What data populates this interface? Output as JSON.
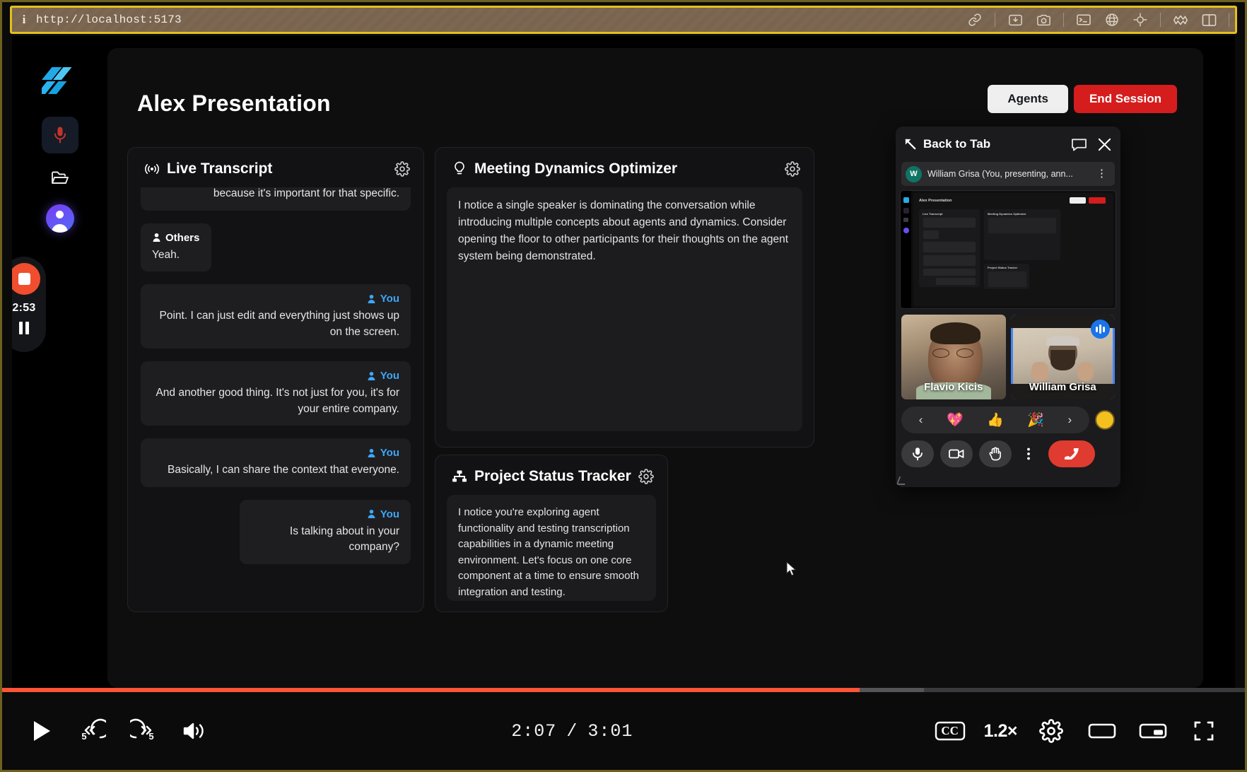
{
  "browser": {
    "info_icon": "info-icon",
    "url": "http://localhost:5173",
    "toolbar_icons": [
      "link-icon",
      "download-image-icon",
      "camera-icon",
      "terminal-icon",
      "globe-icon",
      "target-icon",
      "cloud-icon",
      "panel-split-icon"
    ]
  },
  "sidebar": {
    "logo": "app-logo",
    "items": [
      {
        "name": "microphone-icon",
        "active": true
      },
      {
        "name": "folder-icon",
        "active": false
      },
      {
        "name": "user-avatar",
        "active": false
      }
    ],
    "recorder": {
      "stop_label": "stop-recording",
      "elapsed": "2:53",
      "pause_label": "pause-recording"
    }
  },
  "header": {
    "title": "Alex Presentation",
    "agents_label": "Agents",
    "end_session_label": "End Session"
  },
  "panels": {
    "transcript": {
      "icon": "broadcast-icon",
      "title": "Live Transcript",
      "gear": "settings-gear-icon",
      "messages": [
        {
          "speaker": "",
          "align": "right",
          "clipped": true,
          "text": "A project status tracker added to your meeting because it's important for that specific."
        },
        {
          "speaker": "Others",
          "align": "left",
          "clipped": false,
          "text": "Yeah."
        },
        {
          "speaker": "You",
          "align": "right",
          "clipped": false,
          "text": "Point. I can just edit and everything just shows up on the screen."
        },
        {
          "speaker": "You",
          "align": "right",
          "clipped": false,
          "text": "And another good thing. It's not just for you, it's for your entire company."
        },
        {
          "speaker": "You",
          "align": "right",
          "clipped": false,
          "text": "Basically, I can share the context that everyone."
        },
        {
          "speaker": "You",
          "align": "right",
          "clipped": false,
          "text": "Is talking about in your company?"
        }
      ]
    },
    "dynamics": {
      "icon": "lightbulb-icon",
      "title": "Meeting Dynamics Optimizer",
      "gear": "settings-gear-icon",
      "note": "I notice a single speaker is dominating the conversation while introducing multiple concepts about agents and dynamics. Consider opening the floor to other participants for their thoughts on the agent system being demonstrated."
    },
    "tracker": {
      "icon": "sitemap-icon",
      "title": "Project Status Tracker",
      "gear": "settings-gear-icon",
      "note": "I notice you're exploring agent functionality and testing transcription capabilities in a dynamic meeting environment. Let's focus on one core component at a time to ensure smooth integration and testing."
    }
  },
  "meet": {
    "back_icon": "back-arrow-icon",
    "back_label": "Back to Tab",
    "chat_icon": "chat-bubble-icon",
    "close_icon": "close-icon",
    "participant": {
      "initial": "W",
      "name": "William Grisa (You, presenting, ann...",
      "menu_icon": "more-vertical-icon"
    },
    "share_preview": {
      "title": "Alex Presentation",
      "agents_label": "Agents",
      "end_label": "End Session",
      "panel1": "Live Transcript",
      "panel2": "Meeting Dynamics Optimizer",
      "panel3": "Project Status Tracker"
    },
    "tiles": [
      {
        "name": "Flavio Kicis",
        "selected": false,
        "speaking": false
      },
      {
        "name": "William Grisa",
        "selected": true,
        "speaking": true
      }
    ],
    "reactions": {
      "prev_icon": "chevron-left-icon",
      "emojis": [
        "💖",
        "👍",
        "🎉"
      ],
      "next_icon": "chevron-right-icon",
      "color_swatch": "#f4c020"
    },
    "controls": [
      {
        "name": "microphone-button"
      },
      {
        "name": "camera-button"
      },
      {
        "name": "raise-hand-button"
      },
      {
        "name": "more-options-button"
      },
      {
        "name": "hang-up-button"
      }
    ]
  },
  "player": {
    "play_icon": "play-button",
    "rewind_label": "5",
    "forward_label": "5",
    "volume_icon": "volume-button",
    "current_time": "2:07",
    "separator": "/",
    "duration": "3:01",
    "cc_label": "CC",
    "speed_label": "1.2×",
    "settings_icon": "settings-gear-icon",
    "theater_icon": "theater-mode-button",
    "pip_icon": "picture-in-picture-button",
    "fullscreen_icon": "fullscreen-button",
    "progress_percent": 69
  }
}
